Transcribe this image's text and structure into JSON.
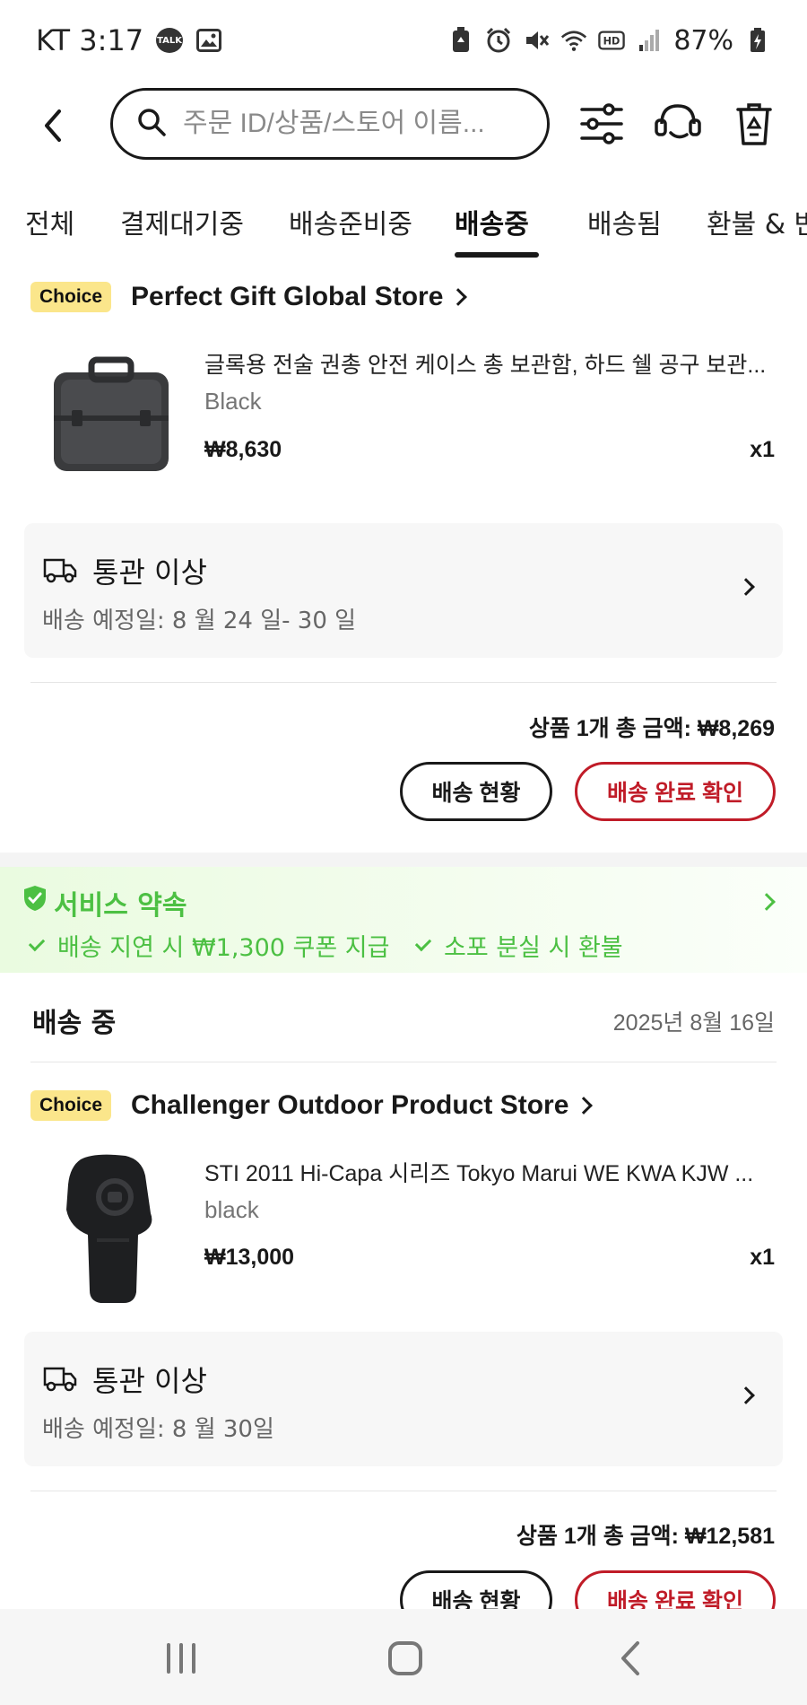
{
  "status_bar": {
    "carrier_time": "KT 3:17",
    "talk_icon_label": "TALK",
    "battery": "87%"
  },
  "search": {
    "placeholder": "주문 ID/상품/스토어 이름..."
  },
  "tabs": [
    "전체",
    "결제대기중",
    "배송준비중",
    "배송중",
    "배송됨",
    "환불 & 반"
  ],
  "active_tab_index": 3,
  "orders": [
    {
      "badge": "Choice",
      "store": "Perfect Gift Global Store",
      "product_title": "글록용 전술 권총 안전 케이스 총 보관함, 하드 쉘 공구 보관...",
      "variant": "Black",
      "price": "₩8,630",
      "qty": "x1",
      "ship_status": "통관 이상",
      "eta": "배송 예정일: 8 월 24 일- 30 일",
      "total": "상품 1개 총 금액: ₩8,269",
      "track_button": "배송 현황",
      "confirm_button": "배송 완료 확인"
    },
    {
      "badge": "Choice",
      "store": "Challenger Outdoor Product Store",
      "product_title": "STI 2011 Hi-Capa 시리즈 Tokyo Marui WE KWA KJW ...",
      "variant": "black",
      "price": "₩13,000",
      "qty": "x1",
      "ship_status": "통관 이상",
      "eta": "배송 예정일: 8 월 30일",
      "total": "상품 1개 총 금액: ₩12,581",
      "track_button": "배송 현황",
      "confirm_button": "배송 완료 확인"
    }
  ],
  "service_promise": {
    "title": "서비스 약속",
    "items": [
      "배송 지연 시 ₩1,300 쿠폰 지급",
      "소포 분실 시 환불"
    ]
  },
  "section": {
    "title": "배송 중",
    "date": "2025년 8월 16일"
  },
  "colors": {
    "accent_red": "#c01c28",
    "promise_green": "#4cc043",
    "choice_badge": "#fbe68b"
  }
}
